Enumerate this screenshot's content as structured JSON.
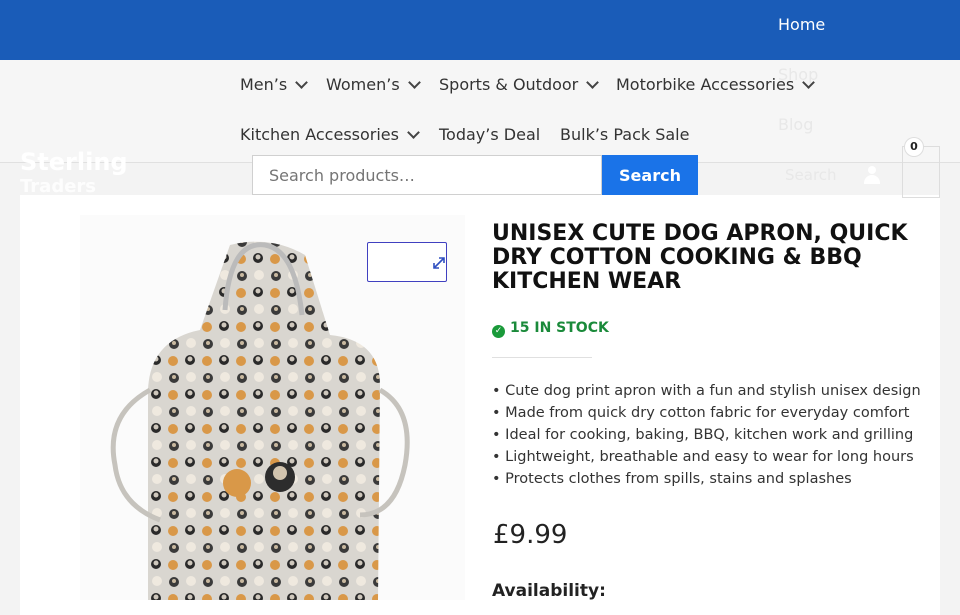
{
  "top_nav": {
    "home": "Home",
    "shop": "Shop",
    "blog": "Blog",
    "search": "Search"
  },
  "menu": {
    "items": [
      {
        "label": "Men’s",
        "dropdown": true
      },
      {
        "label": "Women’s",
        "dropdown": true
      },
      {
        "label": "Sports & Outdoor",
        "dropdown": true
      },
      {
        "label": "Motorbike Accessories",
        "dropdown": true
      },
      {
        "label": "Kitchen Accessories",
        "dropdown": true
      },
      {
        "label": "Today’s Deal",
        "dropdown": false
      },
      {
        "label": "Bulk’s Pack Sale",
        "dropdown": false
      }
    ]
  },
  "logo": {
    "line1": "Sterling",
    "line2": "Traders"
  },
  "search": {
    "placeholder": "Search products…",
    "button": "Search"
  },
  "cart": {
    "count": "0"
  },
  "product": {
    "title": "Unisex Cute Dog Apron, Quick Dry Cotton Cooking & BBQ Kitchen Wear",
    "stock": "15 IN STOCK",
    "features": [
      "Cute dog print apron with a fun and stylish unisex design",
      "Made from quick dry cotton fabric for everyday comfort",
      "Ideal for cooking, baking, BBQ, kitchen work and grilling",
      "Lightweight, breathable and easy to wear for long hours",
      "Protects clothes from spills, stains and splashes"
    ],
    "price": "£9.99",
    "availability_label": "Availability:"
  },
  "colors": {
    "header": "#1a5cb8",
    "search_button": "#1a73e8",
    "stock": "#1a8a3a"
  }
}
